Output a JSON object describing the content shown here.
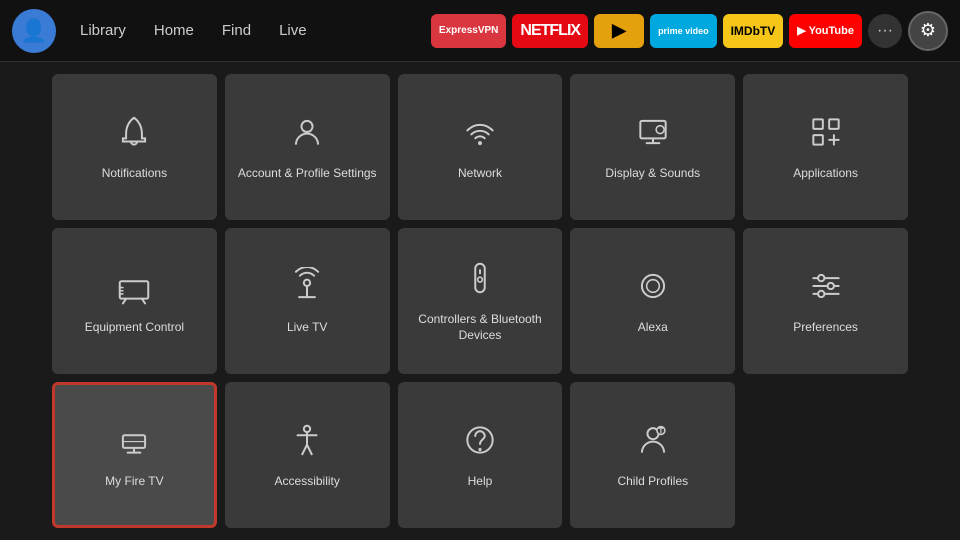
{
  "nav": {
    "links": [
      "Library",
      "Home",
      "Find",
      "Live"
    ],
    "apps": [
      {
        "id": "expressvpn",
        "label": "ExpressVPN",
        "cssClass": "app-expressvpn"
      },
      {
        "id": "netflix",
        "label": "NETFLIX",
        "cssClass": "app-netflix"
      },
      {
        "id": "plex",
        "label": "▶",
        "cssClass": "app-plex"
      },
      {
        "id": "prime",
        "label": "prime video",
        "cssClass": "app-prime"
      },
      {
        "id": "imdb",
        "label": "IMDbTV",
        "cssClass": "app-imdb"
      },
      {
        "id": "youtube",
        "label": "▶ YouTube",
        "cssClass": "app-youtube"
      }
    ],
    "more_label": "···",
    "settings_label": "⚙"
  },
  "grid": {
    "items": [
      {
        "id": "notifications",
        "label": "Notifications",
        "icon": "bell",
        "selected": false
      },
      {
        "id": "account-profile",
        "label": "Account & Profile Settings",
        "icon": "person",
        "selected": false
      },
      {
        "id": "network",
        "label": "Network",
        "icon": "wifi",
        "selected": false
      },
      {
        "id": "display-sounds",
        "label": "Display & Sounds",
        "icon": "display",
        "selected": false
      },
      {
        "id": "applications",
        "label": "Applications",
        "icon": "apps",
        "selected": false
      },
      {
        "id": "equipment-control",
        "label": "Equipment Control",
        "icon": "tv",
        "selected": false
      },
      {
        "id": "live-tv",
        "label": "Live TV",
        "icon": "antenna",
        "selected": false
      },
      {
        "id": "controllers-bluetooth",
        "label": "Controllers & Bluetooth Devices",
        "icon": "remote",
        "selected": false
      },
      {
        "id": "alexa",
        "label": "Alexa",
        "icon": "alexa",
        "selected": false
      },
      {
        "id": "preferences",
        "label": "Preferences",
        "icon": "sliders",
        "selected": false
      },
      {
        "id": "my-fire-tv",
        "label": "My Fire TV",
        "icon": "firetv",
        "selected": true
      },
      {
        "id": "accessibility",
        "label": "Accessibility",
        "icon": "accessibility",
        "selected": false
      },
      {
        "id": "help",
        "label": "Help",
        "icon": "help",
        "selected": false
      },
      {
        "id": "child-profiles",
        "label": "Child Profiles",
        "icon": "childprofile",
        "selected": false
      }
    ]
  }
}
